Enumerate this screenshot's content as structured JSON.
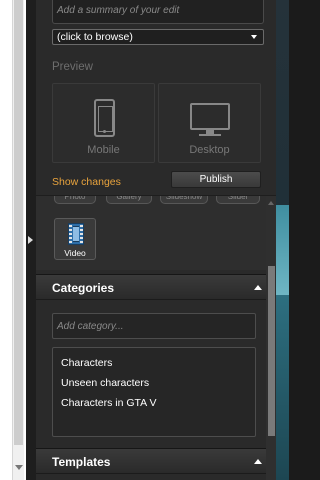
{
  "edit_panel": {
    "summary_placeholder": "Add a summary of your edit",
    "browse_value": "(click to browse)"
  },
  "preview": {
    "heading": "Preview",
    "mobile_label": "Mobile",
    "desktop_label": "Desktop"
  },
  "actions": {
    "show_changes": "Show changes",
    "publish": "Publish"
  },
  "media": {
    "partial_buttons": [
      "Photo",
      "Gallery",
      "Slideshow",
      "Slider"
    ],
    "video_label": "Video"
  },
  "categories": {
    "title": "Categories",
    "input_placeholder": "Add category...",
    "items": [
      "Characters",
      "Unseen characters",
      "Characters in GTA V"
    ]
  },
  "templates": {
    "title": "Templates"
  },
  "icons": {
    "phone": "smartphone-icon",
    "monitor": "desktop-monitor-icon",
    "film": "film-strip-icon"
  },
  "colors": {
    "accent_link": "#e8a33d",
    "panel_bg": "#2a2a2a"
  }
}
